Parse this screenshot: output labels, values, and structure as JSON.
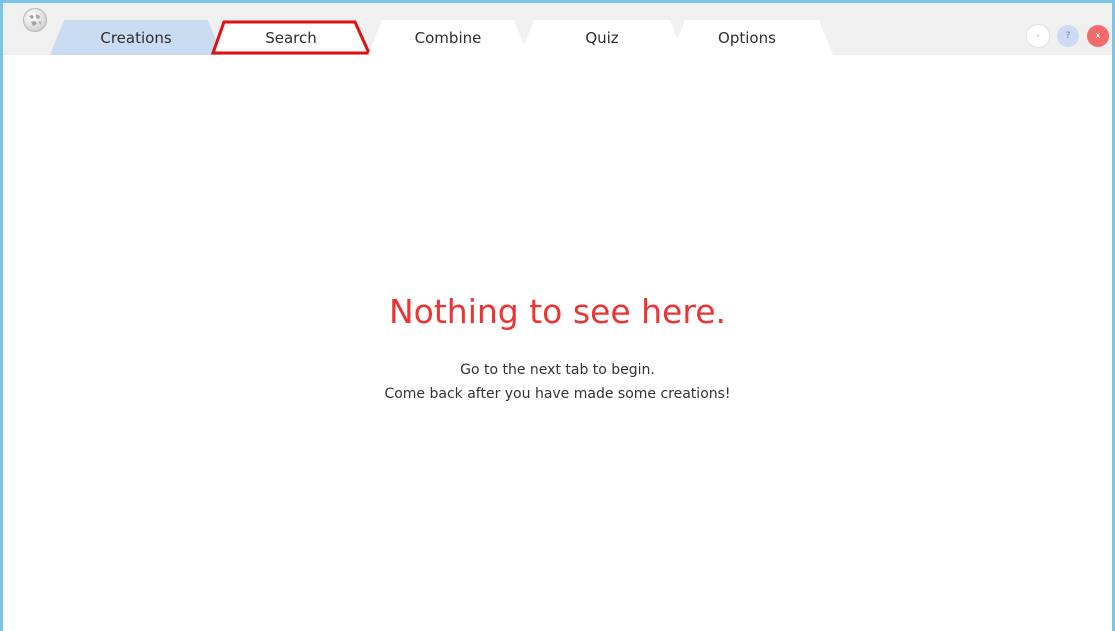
{
  "tabs": [
    {
      "label": "Creations",
      "state": "active"
    },
    {
      "label": "Search",
      "state": "highlighted"
    },
    {
      "label": "Combine",
      "state": "inactive"
    },
    {
      "label": "Quiz",
      "state": "inactive"
    },
    {
      "label": "Options",
      "state": "inactive"
    }
  ],
  "window_controls": {
    "minimize": "-",
    "help": "?",
    "close": "x"
  },
  "main": {
    "title": "Nothing to see here.",
    "line1": "Go to the next tab to begin.",
    "line2": "Come back after you have made some creations!"
  },
  "colors": {
    "frame_border": "#7cc4e6",
    "active_tab": "#c9dcf2",
    "highlight_outline": "#e01010",
    "title_red": "#ef3333",
    "close_button": "#f46a6a",
    "help_button": "#cfd9f4"
  },
  "icons": {
    "app_logo": "globe-icon"
  }
}
